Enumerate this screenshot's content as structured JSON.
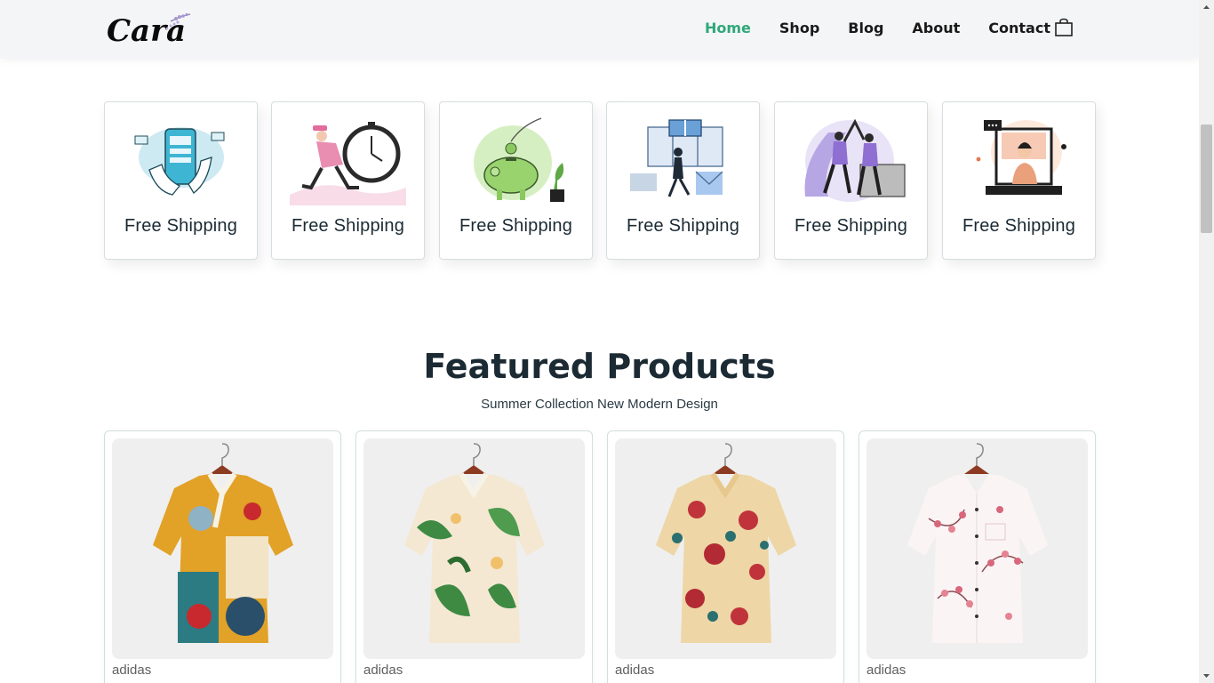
{
  "header": {
    "logo_text": "Cara",
    "nav": [
      "Home",
      "Shop",
      "Blog",
      "About",
      "Contact"
    ],
    "active_nav": "Home",
    "cart_icon": "shopping-bag-icon",
    "accent_color": "#2fa87a"
  },
  "features": [
    {
      "label": "Free Shipping",
      "icon": "online-order-illustration"
    },
    {
      "label": "Free Shipping",
      "icon": "fast-delivery-clock-illustration"
    },
    {
      "label": "Free Shipping",
      "icon": "piggy-bank-savings-illustration"
    },
    {
      "label": "Free Shipping",
      "icon": "gift-promotion-illustration"
    },
    {
      "label": "Free Shipping",
      "icon": "teamwork-high-five-illustration"
    },
    {
      "label": "Free Shipping",
      "icon": "laptop-support-illustration"
    }
  ],
  "featured": {
    "title": "Featured Products",
    "subtitle": "Summer Collection New Modern Design",
    "products": [
      {
        "brand": "adidas",
        "image": "patterned-short-sleeve-shirt"
      },
      {
        "brand": "adidas",
        "image": "tropical-leaf-print-shirt"
      },
      {
        "brand": "adidas",
        "image": "floral-rose-print-shirt"
      },
      {
        "brand": "adidas",
        "image": "pink-blossom-white-shirt"
      }
    ]
  }
}
